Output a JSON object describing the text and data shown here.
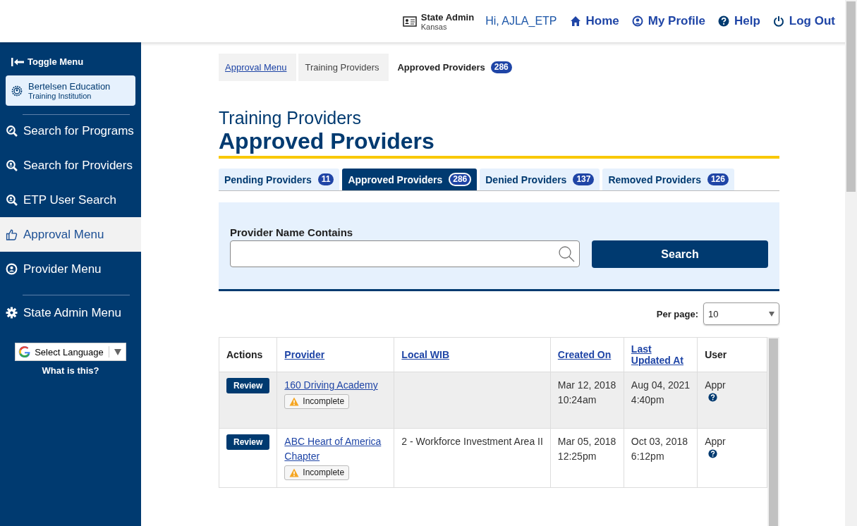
{
  "header": {
    "role": {
      "title": "State Admin",
      "state": "Kansas"
    },
    "greeting": "Hi, AJLA_ETP",
    "links": [
      {
        "label": "Home"
      },
      {
        "label": "My Profile"
      },
      {
        "label": "Help"
      },
      {
        "label": "Log Out"
      }
    ]
  },
  "sidebar": {
    "toggle": "Toggle Menu",
    "org": {
      "name": "Bertelsen Education",
      "type": "Training Institution"
    },
    "items": [
      {
        "label": "Search for Programs",
        "selected": false
      },
      {
        "label": "Search for Providers",
        "selected": false
      },
      {
        "label": "ETP User Search",
        "selected": false
      },
      {
        "label": "Approval Menu",
        "selected": true
      },
      {
        "label": "Provider Menu",
        "selected": false
      },
      {
        "label": "State Admin Menu",
        "selected": false
      }
    ],
    "language": {
      "value": "Select Language",
      "help": "What is this?"
    }
  },
  "breadcrumb": [
    {
      "label": "Approval Menu",
      "kind": "link"
    },
    {
      "label": "Training Providers",
      "kind": "plain"
    },
    {
      "label": "Approved Providers",
      "kind": "current",
      "count": "286"
    }
  ],
  "page": {
    "subtitle": "Training Providers",
    "title": "Approved Providers"
  },
  "tabs": [
    {
      "label": "Pending Providers",
      "count": "11",
      "selected": false
    },
    {
      "label": "Approved Providers",
      "count": "286",
      "selected": true
    },
    {
      "label": "Denied Providers",
      "count": "137",
      "selected": false
    },
    {
      "label": "Removed Providers",
      "count": "126",
      "selected": false
    }
  ],
  "search": {
    "label": "Provider Name Contains",
    "button": "Search"
  },
  "per_page": {
    "label": "Per page:",
    "value": "10"
  },
  "table": {
    "columns": [
      {
        "label": "Actions",
        "sortable": false
      },
      {
        "label": "Provider",
        "sortable": true
      },
      {
        "label": "Local WIB",
        "sortable": true
      },
      {
        "label": "Created On",
        "sortable": true
      },
      {
        "label": "Last Updated At",
        "sortable": true
      },
      {
        "label": "User",
        "sortable": false
      }
    ],
    "rows": [
      {
        "highlighted": true,
        "action": "Review",
        "provider": "160 Driving Academy",
        "status": "Incomplete",
        "wib": "",
        "created": [
          "Mar 12, 2018",
          "10:24am"
        ],
        "updated": [
          "Aug 04, 2021",
          "4:40pm"
        ],
        "user": "Appr"
      },
      {
        "highlighted": false,
        "action": "Review",
        "provider": "ABC Heart of America Chapter",
        "status": "Incomplete",
        "wib": "2 - Workforce Investment Area II",
        "created": [
          "Mar 05, 2018",
          "12:25pm"
        ],
        "updated": [
          "Oct 03, 2018",
          "6:12pm"
        ],
        "user": "Appr"
      }
    ]
  }
}
